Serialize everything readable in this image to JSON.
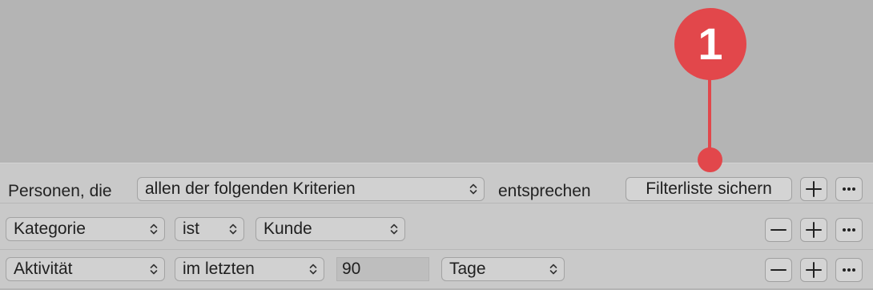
{
  "header_row": {
    "prefix": "Personen, die",
    "match_mode": "allen der folgenden Kriterien",
    "suffix": "entsprechen",
    "save_button": "Filterliste sichern"
  },
  "rules": [
    {
      "field": "Kategorie",
      "operator": "ist",
      "value": "Kunde"
    },
    {
      "field": "Aktivität",
      "operator": "im letzten",
      "amount": "90",
      "unit": "Tage"
    }
  ],
  "callout": {
    "number": "1",
    "color": "#e2474b"
  },
  "icons": {
    "add": "plus-icon",
    "remove": "minus-icon",
    "more": "ellipsis-icon",
    "popup_indicator": "chevron-updown-icon"
  }
}
